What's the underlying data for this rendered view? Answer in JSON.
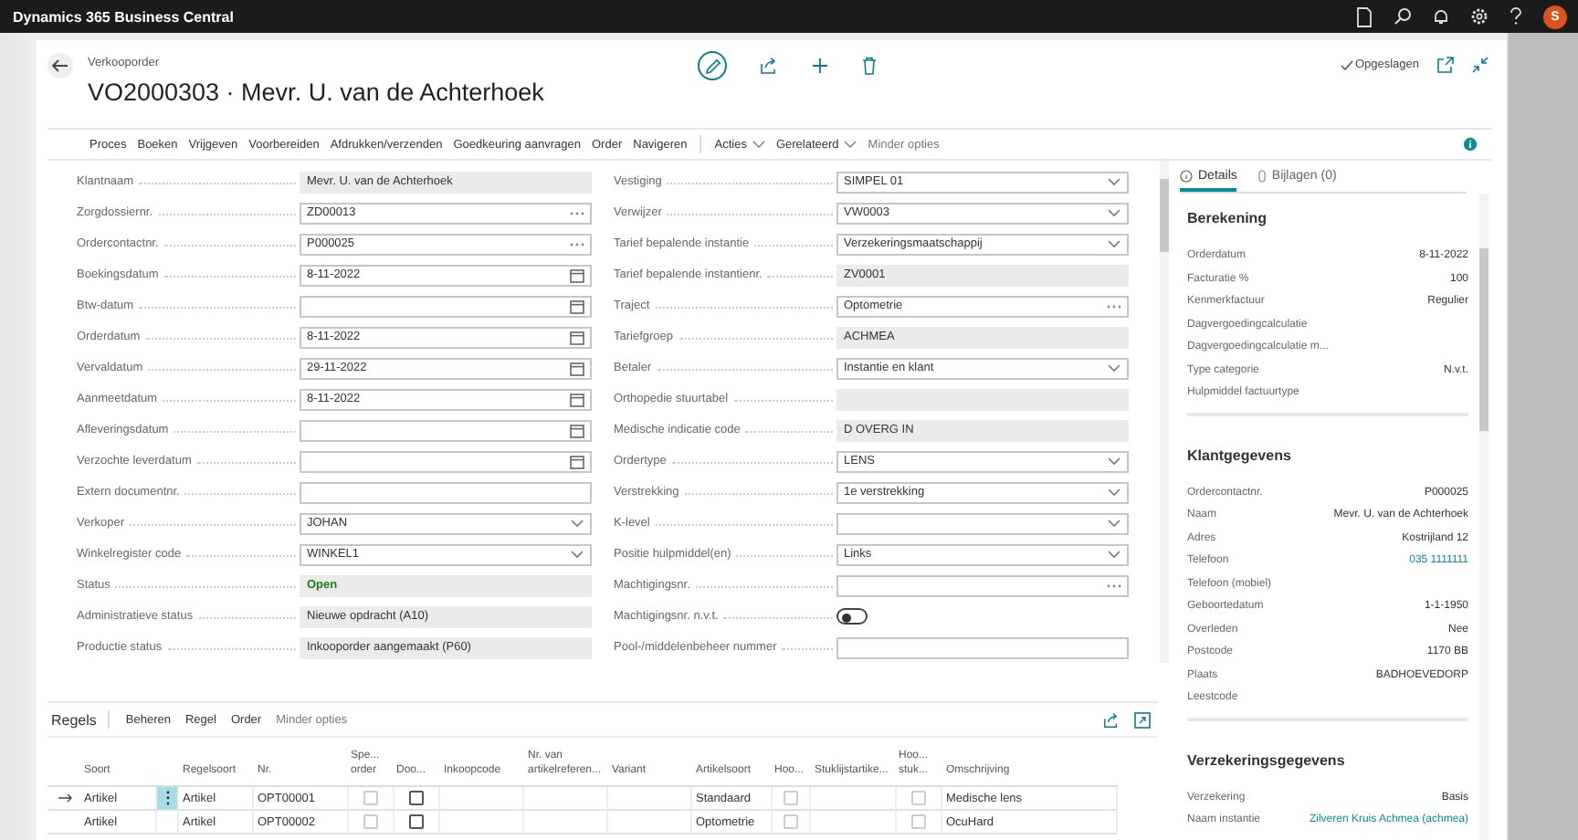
{
  "app_bar": {
    "title": "Dynamics 365 Business Central",
    "avatar": "S"
  },
  "page": {
    "caption": "Verkooporder",
    "title": "VO2000303 · Mevr. U. van de Achterhoek",
    "save_status": "Opgeslagen"
  },
  "actions": [
    {
      "label": "Proces",
      "kind": "plain"
    },
    {
      "label": "Boeken",
      "kind": "plain"
    },
    {
      "label": "Vrijgeven",
      "kind": "plain"
    },
    {
      "label": "Voorbereiden",
      "kind": "plain"
    },
    {
      "label": "Afdrukken/verzenden",
      "kind": "plain"
    },
    {
      "label": "Goedkeuring aanvragen",
      "kind": "plain"
    },
    {
      "label": "Order",
      "kind": "plain"
    },
    {
      "label": "Navigeren",
      "kind": "plain"
    },
    {
      "label": "Acties",
      "kind": "menu"
    },
    {
      "label": "Gerelateerd",
      "kind": "menu"
    },
    {
      "label": "Minder opties",
      "kind": "muted"
    }
  ],
  "fields_left": [
    {
      "label": "Klantnaam",
      "kind": "readonly",
      "value": "Mevr. U. van de Achterhoek"
    },
    {
      "label": "Zorgdossiernr.",
      "kind": "lookup",
      "value": "ZD00013"
    },
    {
      "label": "Ordercontactnr.",
      "kind": "lookup",
      "value": "P000025"
    },
    {
      "label": "Boekingsdatum",
      "kind": "date",
      "value": "8-11-2022"
    },
    {
      "label": "Btw-datum",
      "kind": "date"
    },
    {
      "label": "Orderdatum",
      "kind": "date",
      "value": "8-11-2022"
    },
    {
      "label": "Vervaldatum",
      "kind": "date",
      "value": "29-11-2022"
    },
    {
      "label": "Aanmeetdatum",
      "kind": "date",
      "value": "8-11-2022"
    },
    {
      "label": "Afleveringsdatum",
      "kind": "date"
    },
    {
      "label": "Verzochte leverdatum",
      "kind": "date"
    },
    {
      "label": "Extern documentnr.",
      "kind": "text"
    },
    {
      "label": "Verkoper",
      "kind": "select",
      "value": "JOHAN"
    },
    {
      "label": "Winkelregister code",
      "kind": "select",
      "value": "WINKEL1"
    },
    {
      "label": "Status",
      "kind": "status",
      "value": "Open"
    },
    {
      "label": "Administratieve status",
      "kind": "readonly",
      "value": "Nieuwe opdracht (A10)"
    },
    {
      "label": "Productie status",
      "kind": "readonly",
      "value": "Inkooporder aangemaakt (P60)"
    }
  ],
  "fields_right": [
    {
      "label": "Vestiging",
      "kind": "select",
      "value": "SIMPEL 01"
    },
    {
      "label": "Verwijzer",
      "kind": "select",
      "value": "VW0003"
    },
    {
      "label": "Tarief bepalende instantie",
      "kind": "select",
      "value": "Verzekeringsmaatschappij"
    },
    {
      "label": "Tarief bepalende instantienr.",
      "kind": "readonly",
      "value": "ZV0001"
    },
    {
      "label": "Traject",
      "kind": "lookup",
      "value": "Optometrie"
    },
    {
      "label": "Tariefgroep",
      "kind": "readonly",
      "value": "ACHMEA"
    },
    {
      "label": "Betaler",
      "kind": "select",
      "value": "Instantie en klant"
    },
    {
      "label": "Orthopedie stuurtabel",
      "kind": "readonly"
    },
    {
      "label": "Medische indicatie code",
      "kind": "readonly",
      "value": "D OVERG IN"
    },
    {
      "label": "Ordertype",
      "kind": "select",
      "value": "LENS"
    },
    {
      "label": "Verstrekking",
      "kind": "select",
      "value": "1e verstrekking"
    },
    {
      "label": "K-level",
      "kind": "select"
    },
    {
      "label": "Positie hulpmiddel(en)",
      "kind": "select",
      "value": "Links"
    },
    {
      "label": "Machtigingsnr.",
      "kind": "lookup"
    },
    {
      "label": "Machtigingsnr. n.v.t.",
      "kind": "toggle",
      "on": false
    },
    {
      "label": "Pool-/middelenbeheer nummer",
      "kind": "text"
    }
  ],
  "factbox": {
    "tabs": [
      {
        "label": "Details",
        "selected": true
      },
      {
        "label": "Bijlagen (0)",
        "selected": false
      }
    ],
    "sections": [
      {
        "title": "Berekening",
        "rows": [
          {
            "label": "Orderdatum",
            "value": "8-11-2022"
          },
          {
            "label": "Facturatie %",
            "value": "100"
          },
          {
            "label": "Kenmerkfactuur",
            "value": "Regulier"
          },
          {
            "label": "Dagvergoedingcalculatie"
          },
          {
            "label": "Dagvergoedingcalculatie m..."
          },
          {
            "label": "Type categorie",
            "value": "N.v.t."
          },
          {
            "label": "Hulpmiddel factuurtype"
          }
        ]
      },
      {
        "title": "Klantgegevens",
        "rows": [
          {
            "label": "Ordercontactnr.",
            "value": "P000025"
          },
          {
            "label": "Naam",
            "value": "Mevr. U. van de Achterhoek"
          },
          {
            "label": "Adres",
            "value": "Kostrijland 12"
          },
          {
            "label": "Telefoon",
            "value": "035 1111111",
            "kind": "link"
          },
          {
            "label": "Telefoon (mobiel)"
          },
          {
            "label": "Geboortedatum",
            "value": "1-1-1950"
          },
          {
            "label": "Overleden",
            "value": "Nee"
          },
          {
            "label": "Postcode",
            "value": "1170 BB"
          },
          {
            "label": "Plaats",
            "value": "BADHOEVEDORP"
          },
          {
            "label": "Leestcode"
          }
        ]
      },
      {
        "title": "Verzekeringsgegevens",
        "rows": [
          {
            "label": "Verzekering",
            "value": "Basis"
          },
          {
            "label": "Naam instantie",
            "value": "Zilveren Kruis Achmea (achmea)",
            "kind": "link"
          }
        ]
      }
    ]
  },
  "lines": {
    "title": "Regels",
    "actions": [
      {
        "label": "Beheren",
        "kind": "plain"
      },
      {
        "label": "Regel",
        "kind": "plain"
      },
      {
        "label": "Order",
        "kind": "plain"
      },
      {
        "label": "Minder opties",
        "kind": "muted"
      }
    ],
    "columns": [
      {
        "label": "Soort",
        "kind": "text"
      },
      {
        "kind": "menu"
      },
      {
        "label": "Regelsoort",
        "kind": "text"
      },
      {
        "label": "Nr.",
        "kind": "text"
      },
      {
        "label": "Spe... order",
        "kind": "check",
        "disabled": true
      },
      {
        "label": "Doo...",
        "kind": "check",
        "disabled": false
      },
      {
        "label": "Inkoopcode",
        "kind": "text"
      },
      {
        "label": "Nr. van artikelreferen...",
        "kind": "text"
      },
      {
        "label": "Variant",
        "kind": "text"
      },
      {
        "label": "Artikelsoort",
        "kind": "text"
      },
      {
        "label": "Hoo...",
        "kind": "check",
        "disabled": true
      },
      {
        "label": "Stuklijstartike...",
        "kind": "text"
      },
      {
        "label": "Hoo... stuk...",
        "kind": "check",
        "disabled": true
      },
      {
        "label": "Omschrijving",
        "kind": "text"
      }
    ],
    "rows": [
      {
        "selected": true,
        "cells": [
          "Artikel",
          null,
          "Artikel",
          "OPT00001",
          false,
          false,
          null,
          null,
          null,
          "Standaard",
          false,
          null,
          false,
          "Medische lens"
        ]
      },
      {
        "selected": false,
        "cells": [
          "Artikel",
          null,
          "Artikel",
          "OPT00002",
          false,
          false,
          null,
          null,
          null,
          "Optometrie",
          false,
          null,
          false,
          "OcuHard"
        ]
      }
    ]
  }
}
